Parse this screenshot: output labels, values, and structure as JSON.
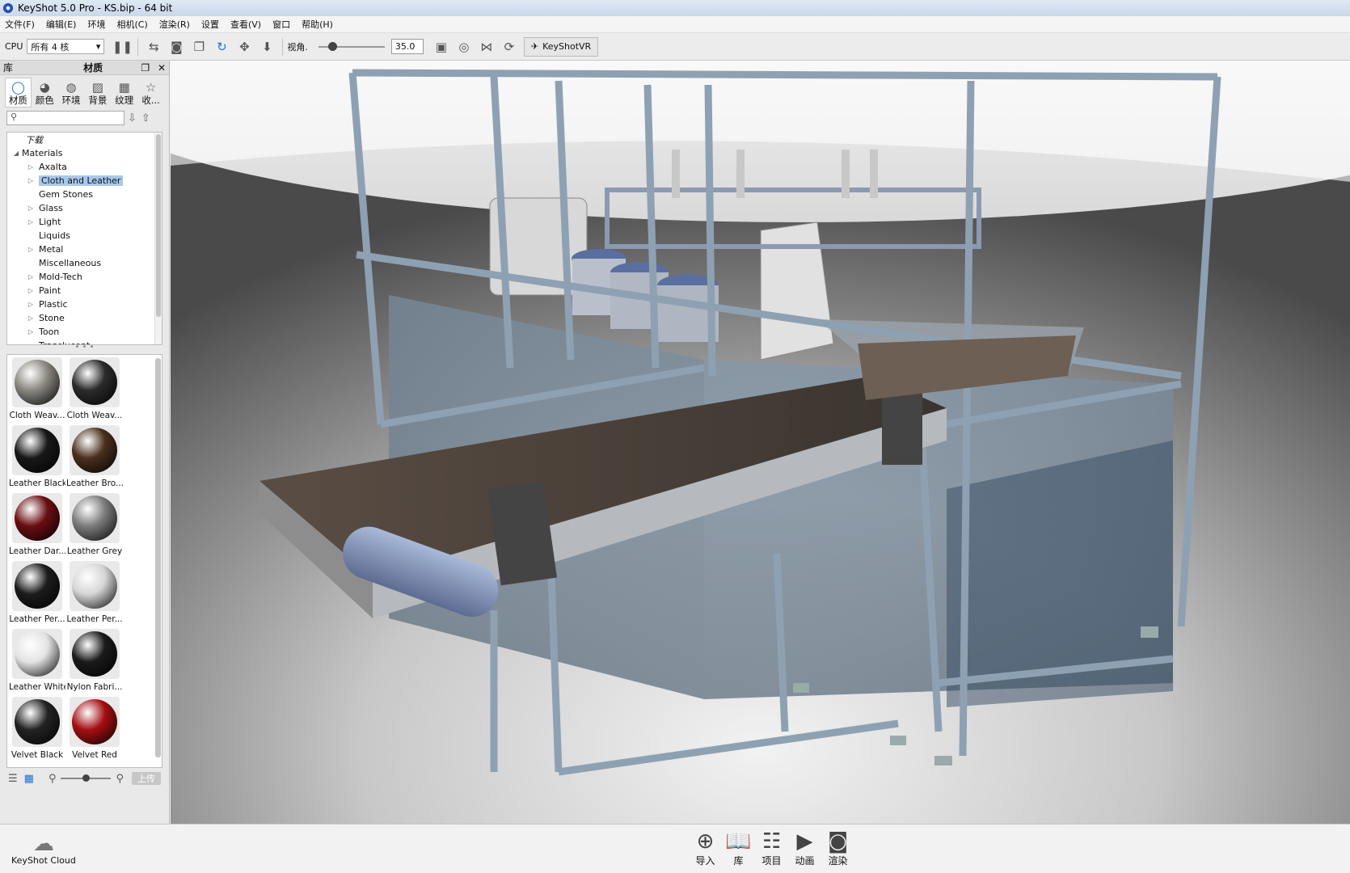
{
  "window": {
    "title": "KeyShot 5.0 Pro  - KS.bip  - 64 bit"
  },
  "menu": [
    "文件(F)",
    "编辑(E)",
    "环境",
    "相机(C)",
    "渲染(R)",
    "设置",
    "查看(V)",
    "窗口",
    "帮助(H)"
  ],
  "toolbar": {
    "cpu_label": "CPU",
    "cpu_select": "所有 4 核",
    "fov_label": "视角.",
    "fov_value": "35.0",
    "vr_label": "KeyShotVR"
  },
  "library": {
    "panel_left": "库",
    "panel_title": "材质",
    "tabs": [
      {
        "label": "材质",
        "icon": "material-icon"
      },
      {
        "label": "颜色",
        "icon": "color-icon"
      },
      {
        "label": "环境",
        "icon": "globe-icon"
      },
      {
        "label": "背景",
        "icon": "image-icon"
      },
      {
        "label": "纹理",
        "icon": "texture-icon"
      },
      {
        "label": "收...",
        "icon": "star-icon"
      }
    ],
    "search_placeholder": "",
    "tree": {
      "top": "下载",
      "root": "Materials",
      "items": [
        {
          "label": "Axalta",
          "has_children": true
        },
        {
          "label": "Cloth and Leather",
          "has_children": true,
          "selected": true
        },
        {
          "label": "Gem Stones",
          "has_children": false
        },
        {
          "label": "Glass",
          "has_children": true
        },
        {
          "label": "Light",
          "has_children": true
        },
        {
          "label": "Liquids",
          "has_children": false
        },
        {
          "label": "Metal",
          "has_children": true
        },
        {
          "label": "Miscellaneous",
          "has_children": false
        },
        {
          "label": "Mold-Tech",
          "has_children": true
        },
        {
          "label": "Paint",
          "has_children": true
        },
        {
          "label": "Plastic",
          "has_children": true
        },
        {
          "label": "Stone",
          "has_children": true
        },
        {
          "label": "Toon",
          "has_children": true
        },
        {
          "label": "Translucent",
          "has_children": false
        }
      ]
    },
    "materials": [
      {
        "label": "Cloth Weav...",
        "color": "#8a8780"
      },
      {
        "label": "Cloth Weav...",
        "color": "#2b2b2b"
      },
      {
        "label": "Leather Black",
        "color": "#181818"
      },
      {
        "label": "Leather Bro...",
        "color": "#4a2f1c"
      },
      {
        "label": "Leather Dar...",
        "color": "#6a0e12"
      },
      {
        "label": "Leather Grey",
        "color": "#7c7c7c"
      },
      {
        "label": "Leather Per...",
        "color": "#1c1c1c"
      },
      {
        "label": "Leather Per...",
        "color": "#d6d6d6"
      },
      {
        "label": "Leather White",
        "color": "#e4e4e4"
      },
      {
        "label": "Nylon Fabri...",
        "color": "#1a1a1a"
      },
      {
        "label": "Velvet Black",
        "color": "#232323"
      },
      {
        "label": "Velvet Red",
        "color": "#a50f12"
      }
    ],
    "upload_label": "上传"
  },
  "status": {
    "cloud_label": "KeyShot Cloud",
    "nav": [
      {
        "label": "导入",
        "icon": "import-icon"
      },
      {
        "label": "库",
        "icon": "book-icon",
        "active": true
      },
      {
        "label": "项目",
        "icon": "list-icon"
      },
      {
        "label": "动画",
        "icon": "play-icon"
      },
      {
        "label": "渲染",
        "icon": "camera-icon"
      }
    ]
  }
}
